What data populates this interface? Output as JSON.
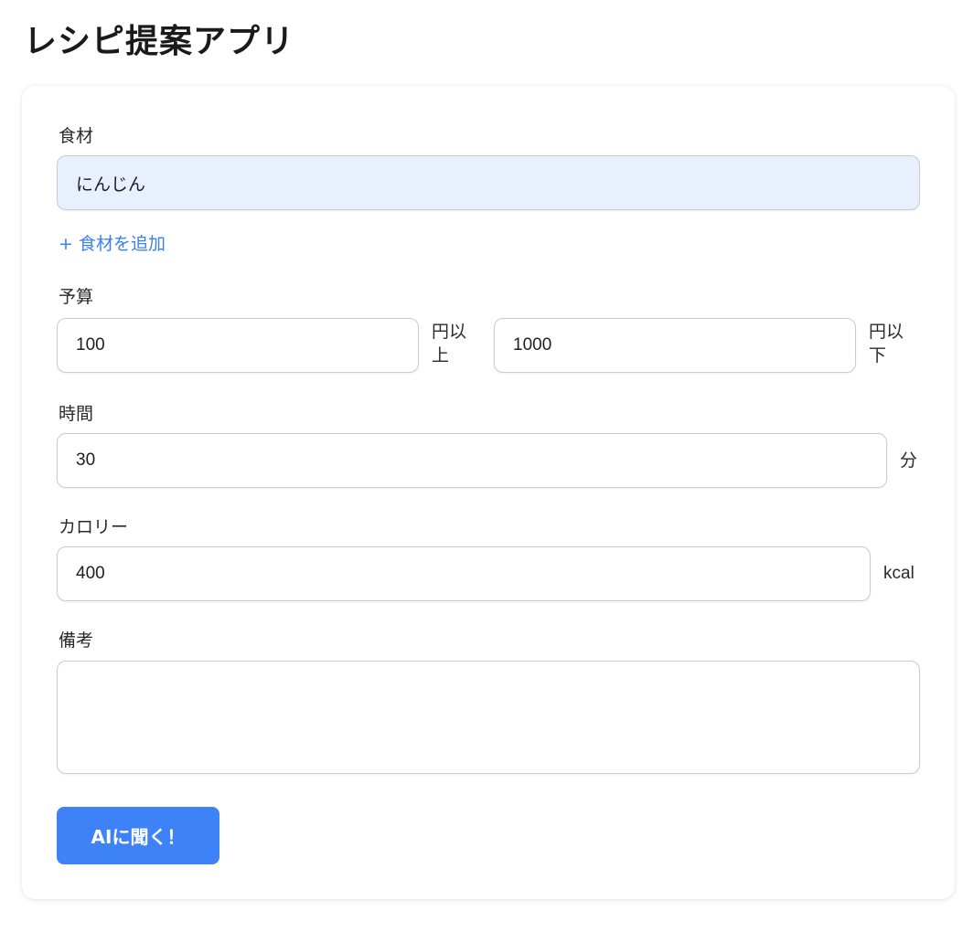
{
  "app": {
    "title": "レシピ提案アプリ"
  },
  "form": {
    "ingredients": {
      "label": "食材",
      "values": [
        "にんじん"
      ],
      "add_label": "+ 食材を追加"
    },
    "budget": {
      "label": "予算",
      "min_value": "100",
      "min_unit": "円以上",
      "max_value": "1000",
      "max_unit": "円以下"
    },
    "time": {
      "label": "時間",
      "value": "30",
      "unit": "分"
    },
    "calories": {
      "label": "カロリー",
      "value": "400",
      "unit": "kcal"
    },
    "notes": {
      "label": "備考",
      "value": ""
    },
    "submit_label": "AIに聞く！"
  },
  "colors": {
    "accent": "#3e82f7",
    "link": "#3b7ff5",
    "filled_input_bg": "#e8f0fd"
  }
}
